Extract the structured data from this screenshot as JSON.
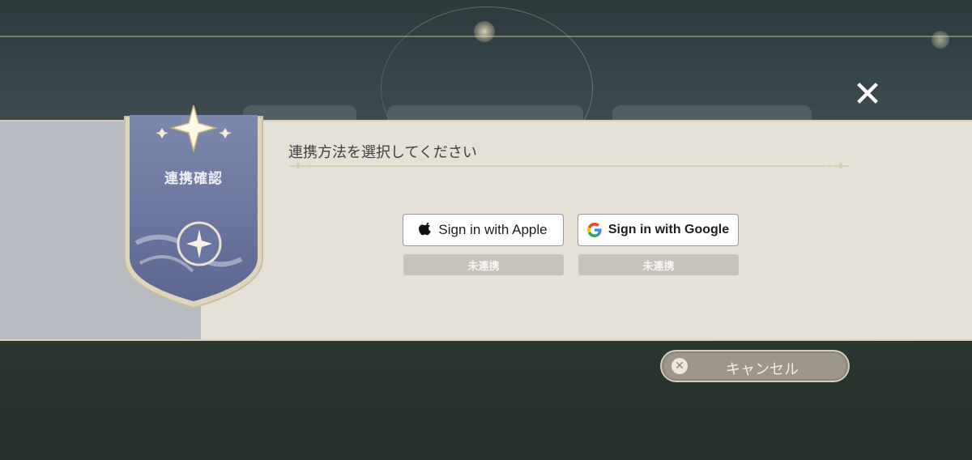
{
  "dialog": {
    "emblem_title": "連携確認",
    "heading": "連携方法を選択してください",
    "close_icon": "close-icon"
  },
  "providers": [
    {
      "label": "Sign in with Apple",
      "status": "未連携",
      "icon": "apple-icon"
    },
    {
      "label": "Sign in with Google",
      "status": "未連携",
      "icon": "google-icon"
    }
  ],
  "cancel": {
    "label": "キャンセル",
    "icon": "close-circle-icon"
  },
  "colors": {
    "band": "#e6e1d6",
    "emblem": "#6f7aa0",
    "status_bg": "#c7c3bb",
    "cancel_bg": "#9d968b"
  }
}
